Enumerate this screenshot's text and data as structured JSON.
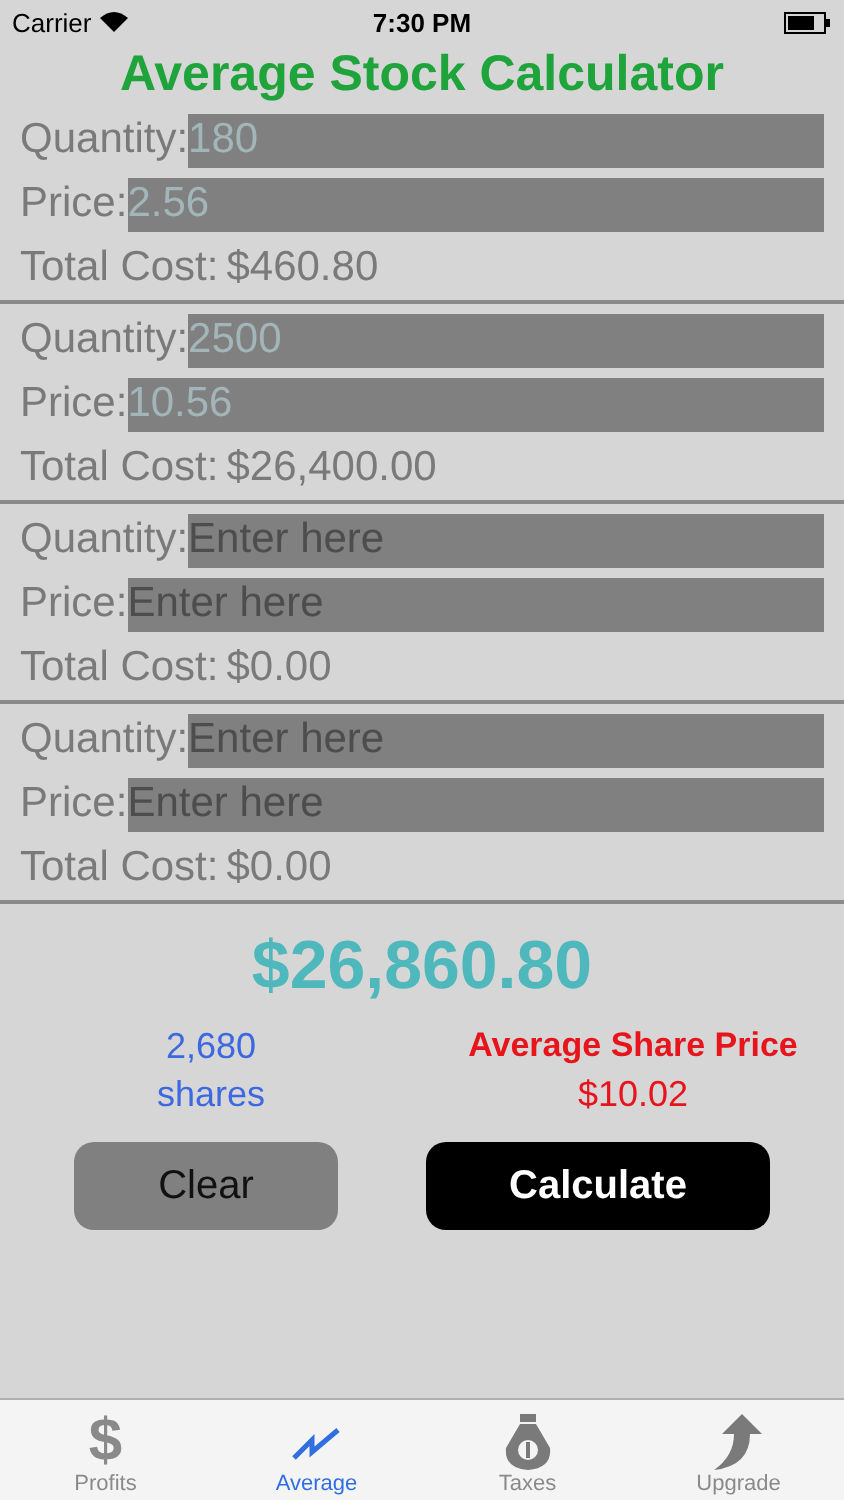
{
  "status_bar": {
    "carrier": "Carrier",
    "time": "7:30 PM"
  },
  "title": "Average Stock Calculator",
  "entries": [
    {
      "quantity_label": "Quantity:",
      "quantity": {
        "value": "180"
      },
      "price_label": "Price:",
      "price": {
        "value": "2.56"
      },
      "total_label": "Total Cost:",
      "total": "$460.80"
    },
    {
      "quantity_label": "Quantity:",
      "quantity": {
        "value": "2500"
      },
      "price_label": "Price:",
      "price": {
        "value": "10.56"
      },
      "total_label": "Total Cost:",
      "total": "$26,400.00"
    },
    {
      "quantity_label": "Quantity:",
      "quantity": {
        "placeholder": "Enter here"
      },
      "price_label": "Price:",
      "price": {
        "placeholder": "Enter here"
      },
      "total_label": "Total Cost:",
      "total": "$0.00"
    },
    {
      "quantity_label": "Quantity:",
      "quantity": {
        "placeholder": "Enter here"
      },
      "price_label": "Price:",
      "price": {
        "placeholder": "Enter here"
      },
      "total_label": "Total Cost:",
      "total": "$0.00"
    }
  ],
  "grand_total": "$26,860.80",
  "shares": {
    "count": "2,680",
    "unit": "shares"
  },
  "average": {
    "label": "Average Share Price",
    "value": "$10.02"
  },
  "buttons": {
    "clear": "Clear",
    "calculate": "Calculate"
  },
  "tabs": [
    {
      "label": "Profits",
      "kind": "dollar",
      "icon_text": "$",
      "selected": false
    },
    {
      "label": "Average",
      "kind": "chart",
      "selected": true
    },
    {
      "label": "Taxes",
      "kind": "bag",
      "selected": false
    },
    {
      "label": "Upgrade",
      "kind": "arrow",
      "selected": false
    }
  ]
}
